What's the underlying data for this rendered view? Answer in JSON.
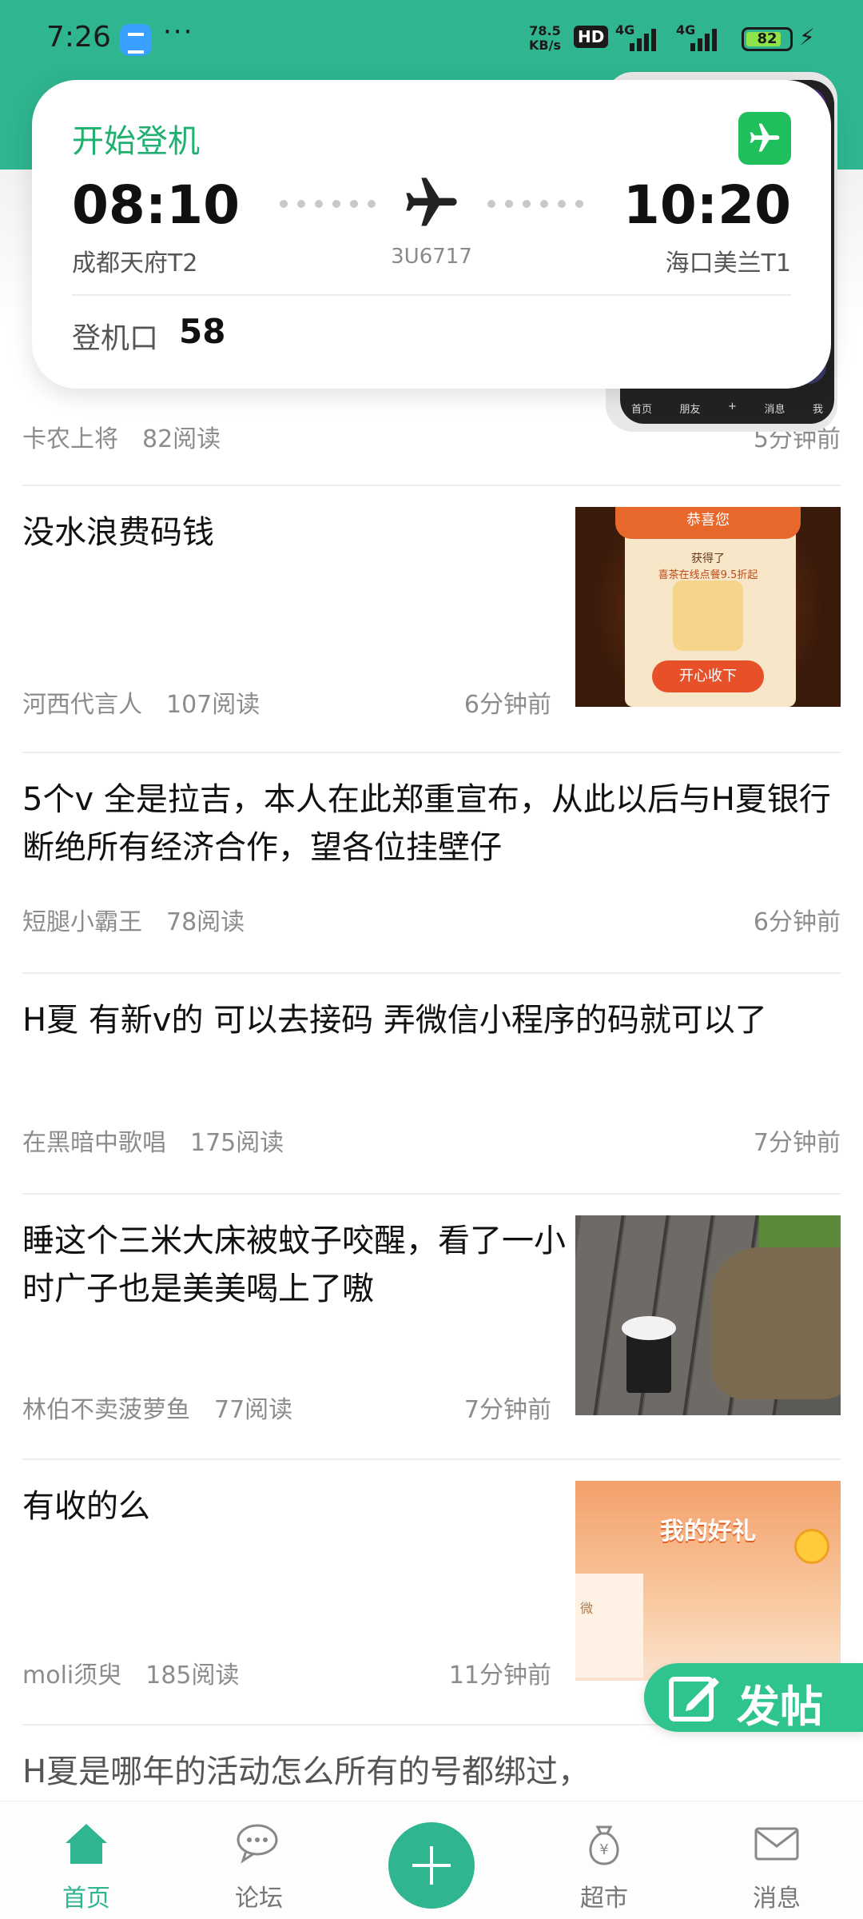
{
  "status_bar": {
    "time": "7:26",
    "more": "···",
    "net_speed_value": "78.5",
    "net_speed_unit": "KB/s",
    "hd": "HD",
    "sim1": "4G",
    "sim2": "4G",
    "battery": "82",
    "charging_icon": "bolt-icon"
  },
  "flight_card": {
    "status": "开始登机",
    "departure_time": "08:10",
    "departure_airport": "成都天府T2",
    "arrival_time": "10:20",
    "arrival_airport": "海口美兰T1",
    "flight_no": "3U6717",
    "gate_label": "登机口",
    "gate": "58",
    "accent": "#20b070"
  },
  "background_preview": {
    "tabs": [
      "首页",
      "朋友",
      "+",
      "消息",
      "我"
    ]
  },
  "posts": [
    {
      "title": "",
      "author": "卡农上将",
      "reads": "82阅读",
      "time": "5分钟前"
    },
    {
      "title": "没水浪费码钱",
      "author": "河西代言人",
      "reads": "107阅读",
      "time": "6分钟前",
      "thumb": {
        "kind": "coupon",
        "header": "恭喜您",
        "line1": "获得了",
        "line2": "喜茶在线点餐9.5折起",
        "button": "开心收下"
      }
    },
    {
      "title": "5个v 全是拉吉，本人在此郑重宣布，从此以后与H夏银行断绝所有经济合作，望各位挂壁仔",
      "author": "短腿小霸王",
      "reads": "78阅读",
      "time": "6分钟前"
    },
    {
      "title": "H夏 有新v的 可以去接码 弄微信小程序的码就可以了",
      "author": "在黑暗中歌唱",
      "reads": "175阅读",
      "time": "7分钟前"
    },
    {
      "title": "睡这个三米大床被蚊子咬醒，看了一小时广子也是美美喝上了嗷",
      "author": "林伯不卖菠萝鱼",
      "reads": "77阅读",
      "time": "7分钟前",
      "thumb": {
        "kind": "photo"
      }
    },
    {
      "title": "有收的么",
      "author": "moli须臾",
      "reads": "185阅读",
      "time": "11分钟前",
      "thumb": {
        "kind": "gift",
        "label": "我的好礼",
        "caption": "微"
      }
    },
    {
      "title": "H夏是哪年的活动怎么所有的号都绑过，",
      "author": "",
      "reads": "",
      "time": ""
    }
  ],
  "fab": {
    "label": "发帖",
    "color": "#2fc48e"
  },
  "bottom_nav": {
    "items": [
      {
        "label": "首页",
        "icon": "home-icon",
        "active": true
      },
      {
        "label": "论坛",
        "icon": "chat-bubbles-icon",
        "active": false
      },
      {
        "label": "",
        "icon": "plus-icon",
        "active": false
      },
      {
        "label": "超市",
        "icon": "money-bag-icon",
        "active": false
      },
      {
        "label": "消息",
        "icon": "mail-icon",
        "active": false
      }
    ],
    "accent": "#2fb58f"
  }
}
